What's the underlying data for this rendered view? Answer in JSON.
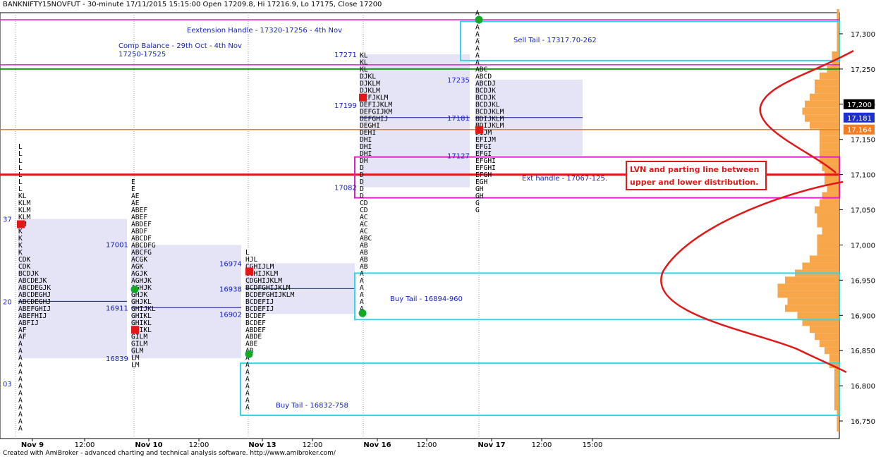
{
  "header": {
    "title": "BANKNIFTY15NOVFUT - 30-minute 17/11/2015 15:15:00 Open 17209.8, Hi 17216.9, Lo 17175, Close 17200"
  },
  "footer": {
    "text": "Created with AmiBroker - advanced charting and technical analysis software. http://www.amibroker.com/"
  },
  "colors": {
    "profile": "#f8a64a",
    "value_area": "#e4e4f6",
    "tail_box": "#33d6e6",
    "handle_box": "#e020c8",
    "red": "#e21818",
    "orange": "#f47b20",
    "green_line": "#139a13",
    "poc": "#0b1b8e",
    "label_blue": "#1722c4",
    "sessionline": "#999999"
  },
  "chart_data": {
    "type": "market-profile",
    "title": "BANKNIFTY15NOVFUT - 30-minute 17/11/2015 15:15:00",
    "ohlc": {
      "open": 17209.8,
      "high": 17216.9,
      "low": 17175,
      "close": 17200
    },
    "ylim": [
      16725,
      17330
    ],
    "y_ticks": [
      16750,
      16800,
      16850,
      16900,
      16950,
      17000,
      17050,
      17100,
      17150,
      17200,
      17250,
      17300
    ],
    "x_tick_labels": [
      "Nov 9",
      "12:00",
      "Nov 10",
      "12:00",
      "Nov 13",
      "12:00",
      "Nov 16",
      "12:00",
      "Nov 17",
      "12:00",
      "15:00"
    ],
    "y_axis_markers": [
      {
        "label": "17,200",
        "value": 17200,
        "style": "black"
      },
      {
        "label": "17,181",
        "value": 17181,
        "style": "blue"
      },
      {
        "label": "17,164",
        "value": 17164,
        "style": "orange"
      }
    ],
    "left_edge_labels": [
      {
        "text": "37",
        "value": 17037
      },
      {
        "text": "20",
        "value": 16920
      },
      {
        "text": "03",
        "value": 16803
      }
    ],
    "horizontal_lines": [
      {
        "value": 17320,
        "color": "handle",
        "role": "extension handle"
      },
      {
        "value": 17256,
        "color": "handle",
        "role": "extension handle"
      },
      {
        "value": 17250,
        "color": "green"
      },
      {
        "value": 17164,
        "color": "orange"
      },
      {
        "value": 17100,
        "color": "red",
        "role": "parting line"
      }
    ],
    "sessions": [
      {
        "date": "Nov 9",
        "value_area": [
          16839,
          17037
        ],
        "poc": 16920,
        "levels": [
          "17037",
          "17001",
          "16920",
          "16911",
          "16839",
          "16803"
        ],
        "profile": [
          [
            17140,
            "L"
          ],
          [
            17130,
            "L"
          ],
          [
            17120,
            "L"
          ],
          [
            17110,
            "L"
          ],
          [
            17100,
            "L"
          ],
          [
            17090,
            "L"
          ],
          [
            17080,
            "L"
          ],
          [
            17070,
            "KL"
          ],
          [
            17060,
            "KLM"
          ],
          [
            17050,
            "KLM"
          ],
          [
            17040,
            "KLM"
          ],
          [
            17030,
            "KM"
          ],
          [
            17020,
            "K"
          ],
          [
            17010,
            "K"
          ],
          [
            17000,
            "K"
          ],
          [
            16990,
            "K"
          ],
          [
            16980,
            "CDK"
          ],
          [
            16970,
            "CDK"
          ],
          [
            16960,
            "BCDJK"
          ],
          [
            16950,
            "ABCDEJK"
          ],
          [
            16940,
            "ABCDEGJK"
          ],
          [
            16930,
            "ABCDEGHJ"
          ],
          [
            16920,
            "ABCDEGHJ"
          ],
          [
            16910,
            "ABEFGHIJ"
          ],
          [
            16900,
            "ABEFHIJ"
          ],
          [
            16890,
            "ABFIJ"
          ],
          [
            16880,
            "AF"
          ],
          [
            16870,
            "AF"
          ],
          [
            16860,
            "A"
          ],
          [
            16850,
            "A"
          ],
          [
            16840,
            "A"
          ],
          [
            16830,
            "A"
          ],
          [
            16820,
            "A"
          ],
          [
            16810,
            "A"
          ],
          [
            16800,
            "A"
          ],
          [
            16790,
            "A"
          ],
          [
            16780,
            "A"
          ],
          [
            16770,
            "A"
          ],
          [
            16760,
            "A"
          ],
          [
            16750,
            "A"
          ],
          [
            16740,
            "A"
          ]
        ]
      },
      {
        "date": "Nov 10",
        "value_area": [
          16839,
          17000
        ],
        "poc": 16911,
        "levels": [
          "16974",
          "16938",
          "16902"
        ],
        "profile": [
          [
            17090,
            "E"
          ],
          [
            17080,
            "E"
          ],
          [
            17070,
            "AE"
          ],
          [
            17060,
            "AE"
          ],
          [
            17050,
            "ABEF"
          ],
          [
            17040,
            "ABEF"
          ],
          [
            17030,
            "ABDEF"
          ],
          [
            17020,
            "ABDF"
          ],
          [
            17010,
            "ABCDF"
          ],
          [
            17000,
            "ABCDFG"
          ],
          [
            16990,
            "ABCFG"
          ],
          [
            16980,
            "ACGK"
          ],
          [
            16970,
            "AGK"
          ],
          [
            16960,
            "AGJK"
          ],
          [
            16950,
            "AGHJK"
          ],
          [
            16940,
            "AGHJK"
          ],
          [
            16930,
            "GHJK"
          ],
          [
            16920,
            "GHJKL"
          ],
          [
            16910,
            "GHIJKL"
          ],
          [
            16900,
            "GHIKL"
          ],
          [
            16890,
            "GHIKL"
          ],
          [
            16880,
            "GHIKL"
          ],
          [
            16870,
            "GILM"
          ],
          [
            16860,
            "GILM"
          ],
          [
            16850,
            "GLM"
          ],
          [
            16840,
            "LM"
          ],
          [
            16830,
            "LM"
          ]
        ]
      },
      {
        "date": "Nov 13",
        "value_area": [
          16902,
          16974
        ],
        "poc": 16938,
        "levels": [],
        "profile": [
          [
            16990,
            "L"
          ],
          [
            16980,
            "HJL"
          ],
          [
            16970,
            "CGHIJLM"
          ],
          [
            16960,
            "CGHIJKLM"
          ],
          [
            16950,
            "CDGHIJKLM"
          ],
          [
            16940,
            "BCDFGHIJKLM"
          ],
          [
            16930,
            "BCDEFGHIJKLM"
          ],
          [
            16920,
            "BCDEFIJ"
          ],
          [
            16910,
            "BCDEFIJ"
          ],
          [
            16900,
            "BCDEF"
          ],
          [
            16890,
            "BCDEF"
          ],
          [
            16880,
            "ABDEF"
          ],
          [
            16870,
            "ABDE"
          ],
          [
            16860,
            "ABE"
          ],
          [
            16850,
            "AB"
          ],
          [
            16840,
            "A"
          ],
          [
            16830,
            "A"
          ],
          [
            16820,
            "A"
          ],
          [
            16810,
            "A"
          ],
          [
            16800,
            "A"
          ],
          [
            16790,
            "A"
          ],
          [
            16780,
            "A"
          ],
          [
            16770,
            "A"
          ]
        ]
      },
      {
        "date": "Nov 16",
        "value_area": [
          17082,
          17271
        ],
        "poc": 17181,
        "levels": [
          "17271",
          "17235",
          "17199",
          "17181",
          "17127",
          "17082"
        ],
        "profile": [
          [
            17270,
            "KL"
          ],
          [
            17260,
            "KL"
          ],
          [
            17250,
            "KL"
          ],
          [
            17240,
            "DJKL"
          ],
          [
            17230,
            "DJKLM"
          ],
          [
            17220,
            "DJKLM"
          ],
          [
            17210,
            "DEFJKLM"
          ],
          [
            17200,
            "DEFIJKLM"
          ],
          [
            17190,
            "DEFGIJKM"
          ],
          [
            17180,
            "DEFGHIJ"
          ],
          [
            17170,
            "DEGHI"
          ],
          [
            17160,
            "DEHI"
          ],
          [
            17150,
            "DHI"
          ],
          [
            17140,
            "DHI"
          ],
          [
            17130,
            "DHI"
          ],
          [
            17120,
            "DH"
          ],
          [
            17110,
            "D"
          ],
          [
            17100,
            "D"
          ],
          [
            17090,
            "D"
          ],
          [
            17080,
            "D"
          ],
          [
            17070,
            "D"
          ],
          [
            17060,
            "CD"
          ],
          [
            17050,
            "CD"
          ],
          [
            17040,
            "AC"
          ],
          [
            17030,
            "AC"
          ],
          [
            17020,
            "AC"
          ],
          [
            17010,
            "ABC"
          ],
          [
            17000,
            "AB"
          ],
          [
            16990,
            "AB"
          ],
          [
            16980,
            "AB"
          ],
          [
            16970,
            "AB"
          ],
          [
            16960,
            "A"
          ],
          [
            16950,
            "A"
          ],
          [
            16940,
            "A"
          ],
          [
            16930,
            "A"
          ],
          [
            16920,
            "A"
          ],
          [
            16910,
            "A"
          ]
        ]
      },
      {
        "date": "Nov 17",
        "value_area": [
          17127,
          17235
        ],
        "poc": 17181,
        "levels": [],
        "profile": [
          [
            17330,
            "A"
          ],
          [
            17320,
            "A"
          ],
          [
            17310,
            "A"
          ],
          [
            17300,
            "A"
          ],
          [
            17290,
            "A"
          ],
          [
            17280,
            "A"
          ],
          [
            17270,
            "A"
          ],
          [
            17260,
            "A"
          ],
          [
            17250,
            "ABC"
          ],
          [
            17240,
            "ABCD"
          ],
          [
            17230,
            "ABCDJ"
          ],
          [
            17220,
            "BCDJK"
          ],
          [
            17210,
            "BCDJK"
          ],
          [
            17200,
            "BCDJKL"
          ],
          [
            17190,
            "BCDJKLM"
          ],
          [
            17180,
            "BDIJKLM"
          ],
          [
            17170,
            "BDIJKLM"
          ],
          [
            17160,
            "DIJM"
          ],
          [
            17150,
            "EFIJM"
          ],
          [
            17140,
            "EFGI"
          ],
          [
            17130,
            "EFGI"
          ],
          [
            17120,
            "EFGHI"
          ],
          [
            17110,
            "EFGHI"
          ],
          [
            17100,
            "EFGH"
          ],
          [
            17090,
            "EGH"
          ],
          [
            17080,
            "GH"
          ],
          [
            17070,
            "GH"
          ],
          [
            17060,
            "G"
          ],
          [
            17050,
            "G"
          ]
        ]
      }
    ],
    "composite_profile_note": "Comp Balance - 29th Oct - 4th Nov",
    "annotations": [
      {
        "text": "Eextension Handle - 17320-17256 - 4th Nov"
      },
      {
        "text": "Comp Balance - 29th Oct - 4th Nov"
      },
      {
        "text": "17250-17525"
      },
      {
        "text": "Sell Tail - 17317.70-262"
      },
      {
        "text": "Buy Tail - 16894-960"
      },
      {
        "text": "Buy Tail - 16832-758"
      },
      {
        "text": "Ext handle - 17067-125."
      },
      {
        "text": "LVN and parting line between"
      },
      {
        "text": "upper and lower distribution."
      }
    ],
    "tail_boxes": [
      {
        "label": "Sell Tail - 17317.70-262",
        "range": [
          17262,
          17317.7
        ]
      },
      {
        "label": "Buy Tail - 16894-960",
        "range": [
          16894,
          16960
        ]
      },
      {
        "label": "Buy Tail - 16832-758",
        "range": [
          16758,
          16832
        ]
      }
    ],
    "handle_boxes": [
      {
        "label": "Ext handle - 17067-125.",
        "range": [
          17067,
          17125
        ]
      }
    ]
  }
}
